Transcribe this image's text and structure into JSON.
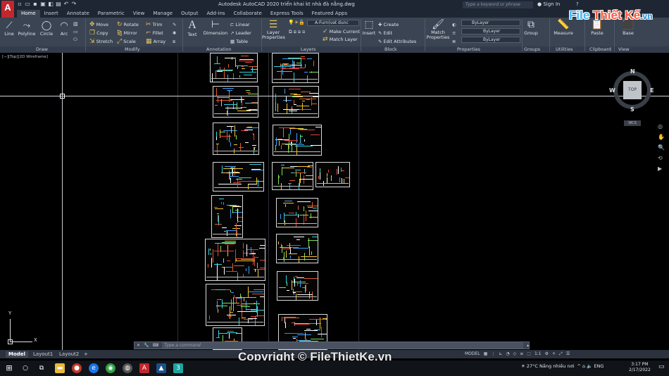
{
  "app": {
    "logo_letter": "A",
    "title": "Autodesk AutoCAD 2020    triển khai kt nhà đà nẵng.dwg",
    "search_placeholder": "Type a keyword or phrase",
    "sign_in": "Sign In",
    "help": "?"
  },
  "menu_tabs": [
    "Home",
    "Insert",
    "Annotate",
    "Parametric",
    "View",
    "Manage",
    "Output",
    "Add-ins",
    "Collaborate",
    "Express Tools",
    "Featured Apps"
  ],
  "ribbon": {
    "draw": {
      "line": "Line",
      "polyline": "Polyline",
      "circle": "Circle",
      "arc": "Arc",
      "label": "Draw"
    },
    "modify": {
      "move": "Move",
      "rotate": "Rotate",
      "trim": "Trim",
      "copy": "Copy",
      "mirror": "Mirror",
      "fillet": "Fillet",
      "stretch": "Stretch",
      "scale": "Scale",
      "array": "Array",
      "label": "Modify"
    },
    "annotation": {
      "text": "Text",
      "dimension": "Dimension",
      "linear": "Linear",
      "leader": "Leader",
      "table": "Table",
      "label": "Annotation"
    },
    "layers": {
      "layer_properties": "Layer Properties",
      "current_layer": "A-Furn(vat dunc",
      "make_current": "Make Current",
      "match_layer": "Match Layer",
      "label": "Layers"
    },
    "block": {
      "insert": "Insert",
      "create": "Create",
      "edit": "Edit",
      "edit_attributes": "Edit Attributes",
      "label": "Block"
    },
    "properties": {
      "match": "Match Properties",
      "color": "ByLayer",
      "linetype": "ByLayer",
      "lineweight": "ByLayer",
      "label": "Properties"
    },
    "groups": {
      "group": "Group",
      "label": "Groups"
    },
    "utilities": {
      "measure": "Measure",
      "label": "Utilities"
    },
    "clipboard": {
      "paste": "Paste",
      "label": "Clipboard"
    },
    "view": {
      "base": "Base",
      "label": "View"
    }
  },
  "viewport": {
    "label": "[−][Top][2D Wireframe]",
    "viewcube": {
      "north": "N",
      "south": "S",
      "east": "E",
      "west": "W",
      "face": "TOP",
      "wcs": "WCS"
    },
    "ucs": {
      "x": "X",
      "y": "Y"
    }
  },
  "command": {
    "placeholder": "Type a command"
  },
  "layout_tabs": [
    "Model",
    "Layout1",
    "Layout2"
  ],
  "status": {
    "mode": "MODEL",
    "scale": "1:1"
  },
  "watermark": "Copyright © FileThietKe.vn",
  "brand": {
    "part1": "File",
    "part2": "Thiết Kế",
    "part3": ".vn"
  },
  "taskbar": {
    "weather": "27°C  Nắng nhiều nơi",
    "lang": "ENG",
    "time": "3:17 PM",
    "date": "2/17/2022"
  },
  "colors": {
    "accent_red": "#c1272d",
    "ribbon_bg": "#3b4453",
    "title_bg": "#1e2633"
  }
}
